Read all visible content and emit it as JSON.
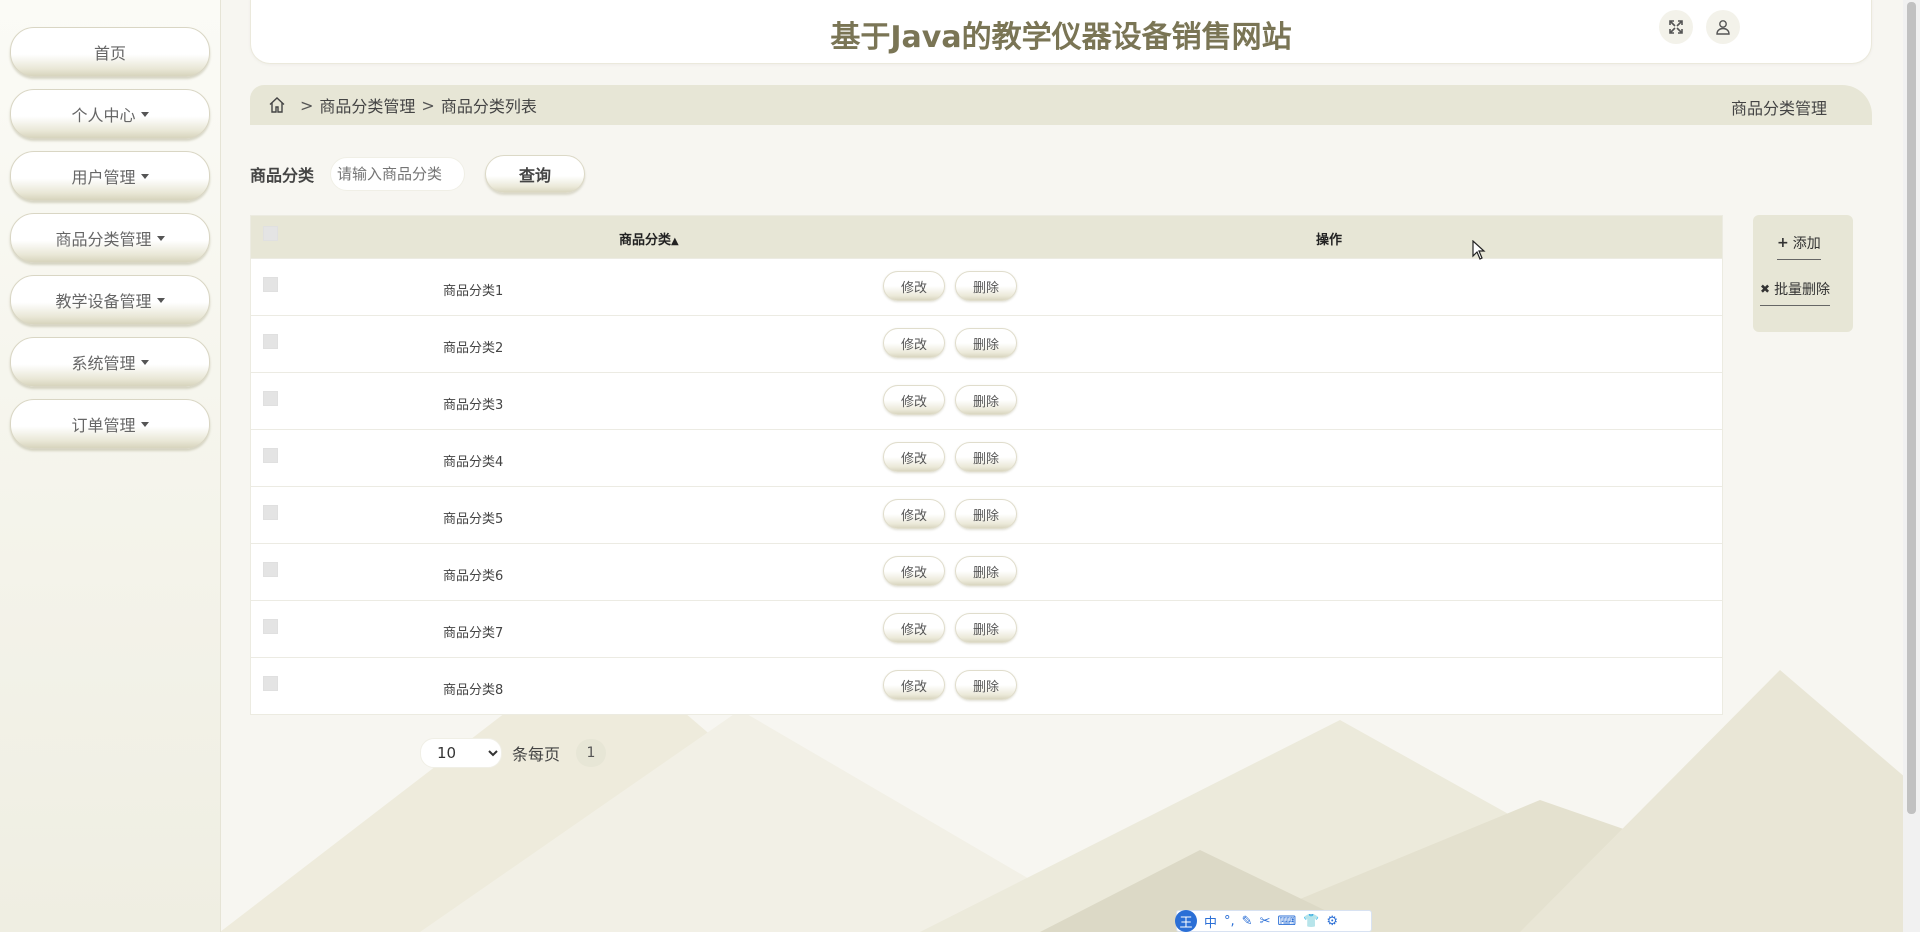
{
  "site_title": "基于Java的教学仪器设备销售网站",
  "sidebar": {
    "items": [
      {
        "label": "首页",
        "has_caret": false
      },
      {
        "label": "个人中心",
        "has_caret": true
      },
      {
        "label": "用户管理",
        "has_caret": true
      },
      {
        "label": "商品分类管理",
        "has_caret": true
      },
      {
        "label": "教学设备管理",
        "has_caret": true
      },
      {
        "label": "系统管理",
        "has_caret": true
      },
      {
        "label": "订单管理",
        "has_caret": true
      }
    ]
  },
  "header": {
    "fullscreen_icon": "expand-icon",
    "user_icon": "user-icon"
  },
  "breadcrumb": {
    "home_icon": "home-icon",
    "sep": ">",
    "items": [
      "商品分类管理",
      "商品分类列表"
    ],
    "right_title": "商品分类管理"
  },
  "search": {
    "label": "商品分类",
    "placeholder": "请输入商品分类",
    "button": "查询"
  },
  "table": {
    "columns": {
      "name": "商品分类",
      "ops": "操作"
    },
    "edit_label": "修改",
    "delete_label": "删除",
    "rows": [
      "商品分类1",
      "商品分类2",
      "商品分类3",
      "商品分类4",
      "商品分类5",
      "商品分类6",
      "商品分类7",
      "商品分类8"
    ]
  },
  "right_panel": {
    "add": "添加",
    "batch_delete": "批量删除"
  },
  "pager": {
    "page_size": "10",
    "page_size_label": "条每页",
    "current_page": "1"
  },
  "ime": {
    "logo": "王",
    "items": [
      "中",
      "°,",
      "✎",
      "✂",
      "⌨",
      "👕",
      "⚙"
    ]
  },
  "colors": {
    "accent_bar": "#e7e6d6",
    "title": "#7a7555",
    "ime_blue": "#2b6fd6"
  }
}
